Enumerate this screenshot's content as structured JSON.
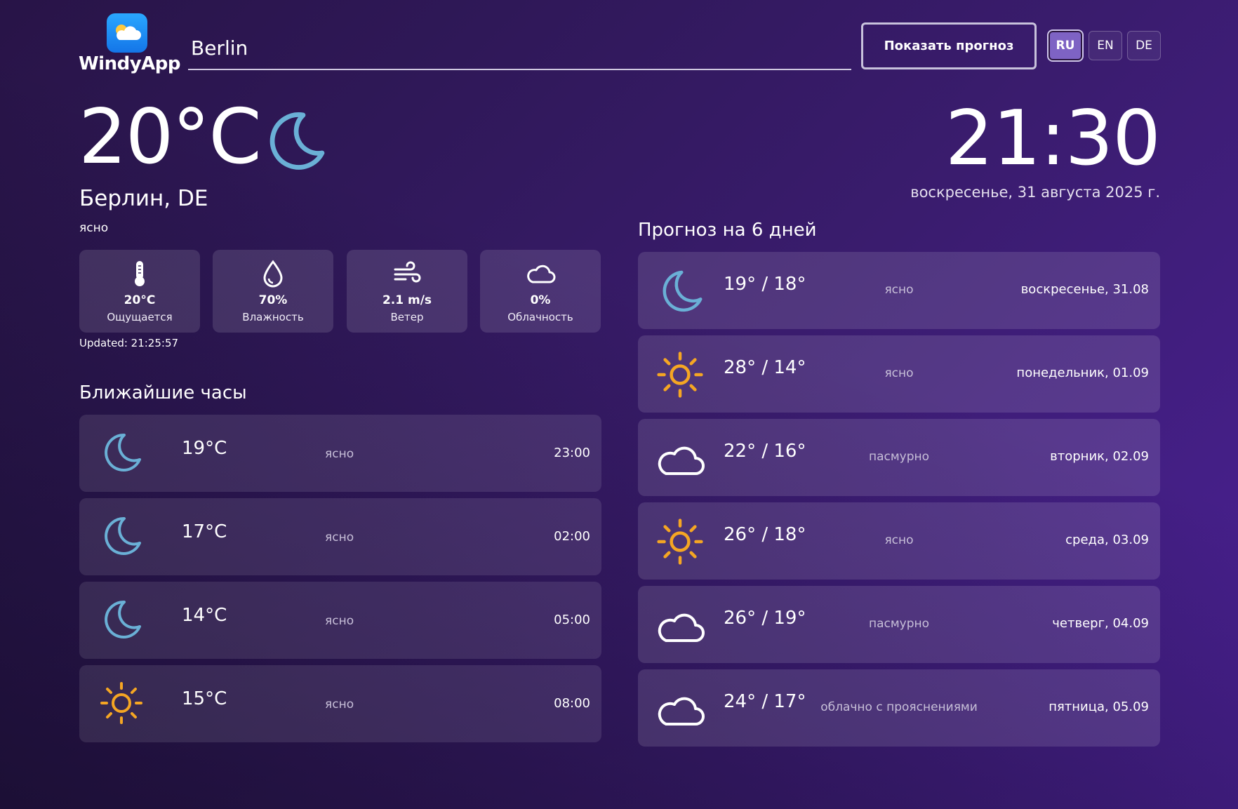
{
  "header": {
    "app_name": "WindyApp",
    "city_value": "Berlin",
    "show_button": "Показать прогноз",
    "languages": [
      "RU",
      "EN",
      "DE"
    ],
    "active_language": "RU"
  },
  "current": {
    "temperature": "20°C",
    "icon": "moon-icon",
    "location": "Берлин, DE",
    "description": "ясно",
    "time": "21:30",
    "date": "воскресенье, 31 августа 2025 г.",
    "updated": "Updated: 21:25:57",
    "stats": [
      {
        "icon": "thermometer-icon",
        "value": "20°C",
        "label": "Ощущается"
      },
      {
        "icon": "droplet-icon",
        "value": "70%",
        "label": "Влажность"
      },
      {
        "icon": "wind-icon",
        "value": "2.1 m/s",
        "label": "Ветер"
      },
      {
        "icon": "cloud-icon",
        "value": "0%",
        "label": "Облачность"
      }
    ]
  },
  "hourly": {
    "title": "Ближайшие часы",
    "items": [
      {
        "icon": "moon-icon",
        "temp": "19°C",
        "desc": "ясно",
        "time": "23:00"
      },
      {
        "icon": "moon-icon",
        "temp": "17°C",
        "desc": "ясно",
        "time": "02:00"
      },
      {
        "icon": "moon-icon",
        "temp": "14°C",
        "desc": "ясно",
        "time": "05:00"
      },
      {
        "icon": "sun-icon",
        "temp": "15°C",
        "desc": "ясно",
        "time": "08:00"
      }
    ]
  },
  "daily": {
    "title": "Прогноз на 6 дней",
    "items": [
      {
        "icon": "moon-icon",
        "temp": "19° / 18°",
        "desc": "ясно",
        "day": "воскресенье, 31.08"
      },
      {
        "icon": "sun-icon",
        "temp": "28° / 14°",
        "desc": "ясно",
        "day": "понедельник, 01.09"
      },
      {
        "icon": "cloud-icon",
        "temp": "22° / 16°",
        "desc": "пасмурно",
        "day": "вторник, 02.09"
      },
      {
        "icon": "sun-icon",
        "temp": "26° / 18°",
        "desc": "ясно",
        "day": "среда, 03.09"
      },
      {
        "icon": "cloud-icon",
        "temp": "26° / 19°",
        "desc": "пасмурно",
        "day": "четверг, 04.09"
      },
      {
        "icon": "cloud-icon",
        "temp": "24° / 17°",
        "desc": "облачно с прояснениями",
        "day": "пятница, 05.09"
      }
    ]
  },
  "colors": {
    "moon": "#6ab0d6",
    "sun": "#f5a623",
    "cloud": "#ffffff",
    "accent_active_lang": "#7e63c4"
  }
}
